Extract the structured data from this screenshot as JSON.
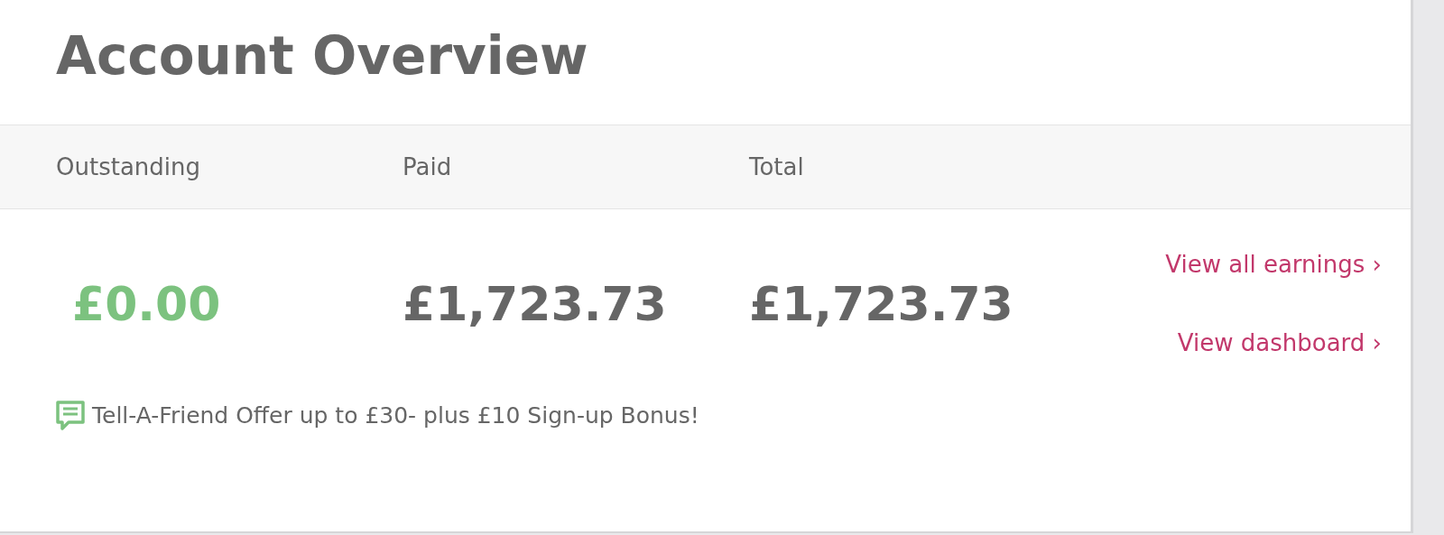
{
  "title": "Account Overview",
  "columns": [
    {
      "label": "Outstanding",
      "amount": "£0.00",
      "color": "#7cc27f"
    },
    {
      "label": "Paid",
      "amount": "£1,723.73",
      "color": "#666666"
    },
    {
      "label": "Total",
      "amount": "£1,723.73",
      "color": "#666666"
    }
  ],
  "links": [
    "View all earnings ›",
    "View dashboard ›"
  ],
  "offer": "Tell-A-Friend Offer up to £30- plus £10 Sign-up Bonus!"
}
